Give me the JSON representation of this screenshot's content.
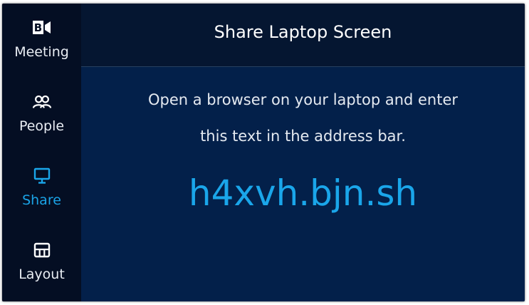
{
  "sidebar": {
    "items": [
      {
        "label": "Meeting",
        "icon": "meeting-camera-icon",
        "active": false
      },
      {
        "label": "People",
        "icon": "people-icon",
        "active": false
      },
      {
        "label": "Share",
        "icon": "monitor-icon",
        "active": true
      },
      {
        "label": "Layout",
        "icon": "layout-grid-icon",
        "active": false
      }
    ]
  },
  "header": {
    "title": "Share Laptop Screen"
  },
  "main": {
    "instruction_line1": "Open a browser on your laptop and enter",
    "instruction_line2": "this text in the address bar.",
    "share_url": "h4xvh.bjn.sh"
  },
  "colors": {
    "accent": "#1aa6ea",
    "sidebar_bg": "#040e23",
    "main_bg": "#03204a",
    "header_bg": "#051631",
    "text": "#ffffff"
  }
}
